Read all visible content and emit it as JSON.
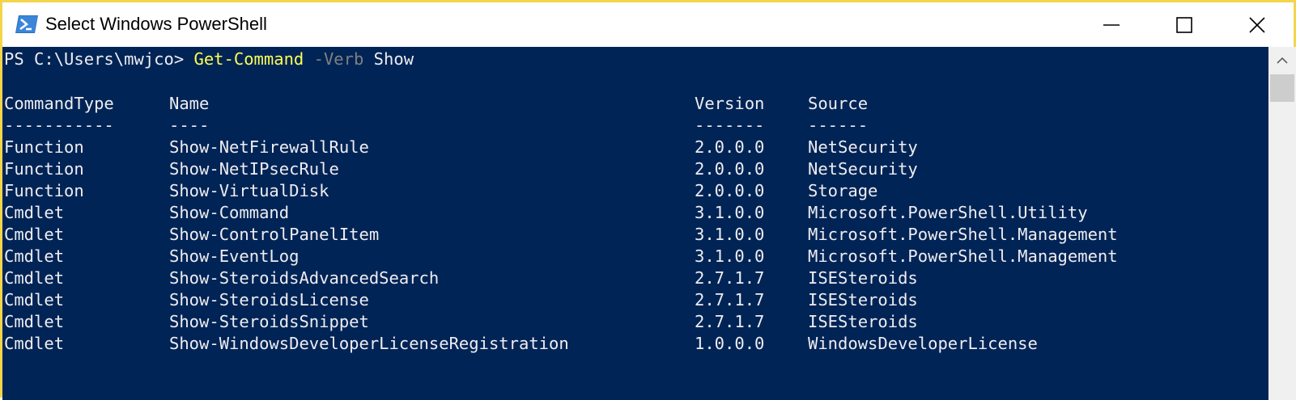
{
  "window": {
    "title": "Select Windows PowerShell",
    "icon": "powershell-icon",
    "controls": [
      "minimize-icon",
      "maximize-icon",
      "close-icon"
    ],
    "border_color": "#f2d54a"
  },
  "console": {
    "background": "#012456",
    "prompt": {
      "path": "PS C:\\Users\\mwjco> ",
      "command": "Get-Command",
      "parameter": " -Verb",
      "argument": " Show"
    },
    "table": {
      "headers": [
        "CommandType",
        "Name",
        "Version",
        "Source"
      ],
      "dividers": [
        "-----------",
        "----",
        "-------",
        "------"
      ],
      "rows": [
        [
          "Function",
          "Show-NetFirewallRule",
          "2.0.0.0",
          "NetSecurity"
        ],
        [
          "Function",
          "Show-NetIPsecRule",
          "2.0.0.0",
          "NetSecurity"
        ],
        [
          "Function",
          "Show-VirtualDisk",
          "2.0.0.0",
          "Storage"
        ],
        [
          "Cmdlet",
          "Show-Command",
          "3.1.0.0",
          "Microsoft.PowerShell.Utility"
        ],
        [
          "Cmdlet",
          "Show-ControlPanelItem",
          "3.1.0.0",
          "Microsoft.PowerShell.Management"
        ],
        [
          "Cmdlet",
          "Show-EventLog",
          "3.1.0.0",
          "Microsoft.PowerShell.Management"
        ],
        [
          "Cmdlet",
          "Show-SteroidsAdvancedSearch",
          "2.7.1.7",
          "ISESteroids"
        ],
        [
          "Cmdlet",
          "Show-SteroidsLicense",
          "2.7.1.7",
          "ISESteroids"
        ],
        [
          "Cmdlet",
          "Show-SteroidsSnippet",
          "2.7.1.7",
          "ISESteroids"
        ],
        [
          "Cmdlet",
          "Show-WindowsDeveloperLicenseRegistration",
          "1.0.0.0",
          "WindowsDeveloperLicense"
        ]
      ]
    }
  }
}
